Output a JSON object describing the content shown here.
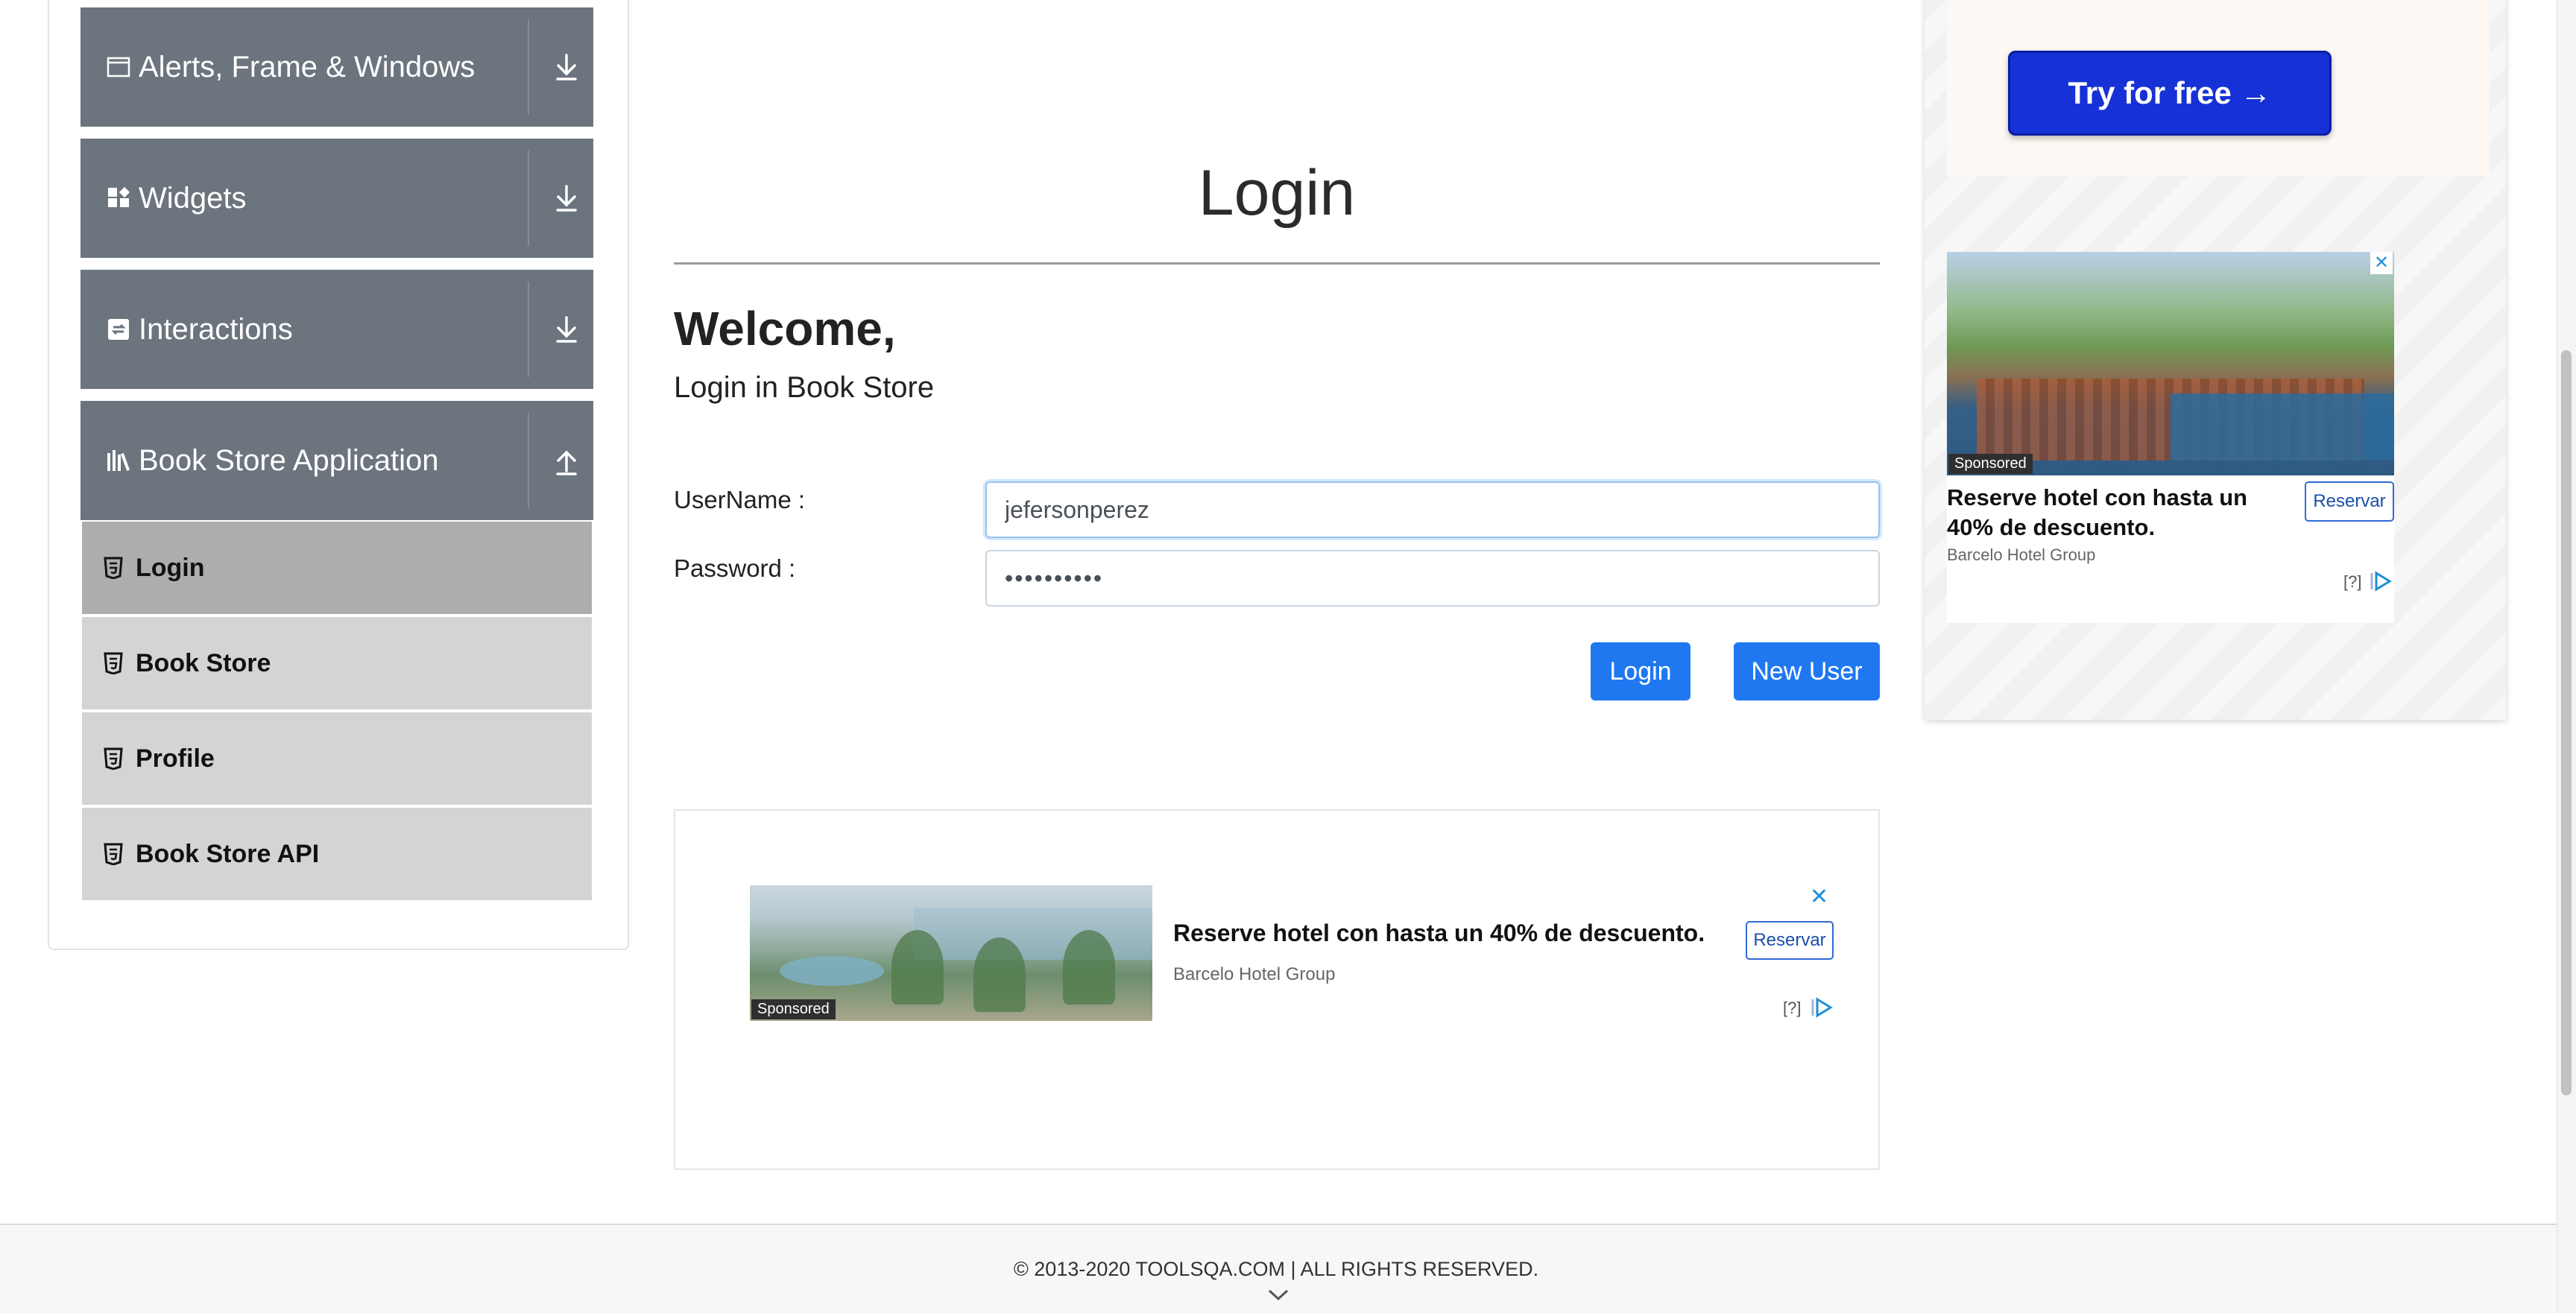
{
  "sidebar": {
    "groups": [
      {
        "label": "Alerts, Frame & Windows",
        "icon": "window-icon",
        "expanded": false
      },
      {
        "label": "Widgets",
        "icon": "widgets-icon",
        "expanded": false
      },
      {
        "label": "Interactions",
        "icon": "interactions-icon",
        "expanded": false
      },
      {
        "label": "Book Store Application",
        "icon": "books-icon",
        "expanded": true
      }
    ],
    "items": [
      {
        "label": "Login",
        "active": true
      },
      {
        "label": "Book Store",
        "active": false
      },
      {
        "label": "Profile",
        "active": false
      },
      {
        "label": "Book Store API",
        "active": false
      }
    ]
  },
  "main": {
    "title": "Login",
    "welcome": "Welcome,",
    "subtitle": "Login in Book Store",
    "username_label": "UserName :",
    "username_value": "jefersonperez",
    "password_label": "Password :",
    "password_value": "••••••••••",
    "login_button": "Login",
    "new_user_button": "New User"
  },
  "ad_bottom": {
    "sponsored": "Sponsored",
    "headline": "Reserve hotel con hasta un 40% de descuento.",
    "brand": "Barcelo Hotel Group",
    "cta": "Reservar",
    "info": "[?]",
    "close": "✕"
  },
  "ad_side": {
    "try_button": "Try for free →",
    "sponsored": "Sponsored",
    "headline": "Reserve hotel con hasta un 40% de descuento.",
    "brand": "Barcelo Hotel Group",
    "cta": "Reservar",
    "info": "[?]",
    "close": "✕"
  },
  "footer": {
    "copyright": "© 2013-2020 TOOLSQA.COM | ALL RIGHTS RESERVED."
  },
  "colors": {
    "group_header": "#6c757d",
    "menu_item": "#d4d4d4",
    "menu_item_active": "#adadad",
    "primary_button": "#1f78f0",
    "try_button": "#1632d6"
  }
}
